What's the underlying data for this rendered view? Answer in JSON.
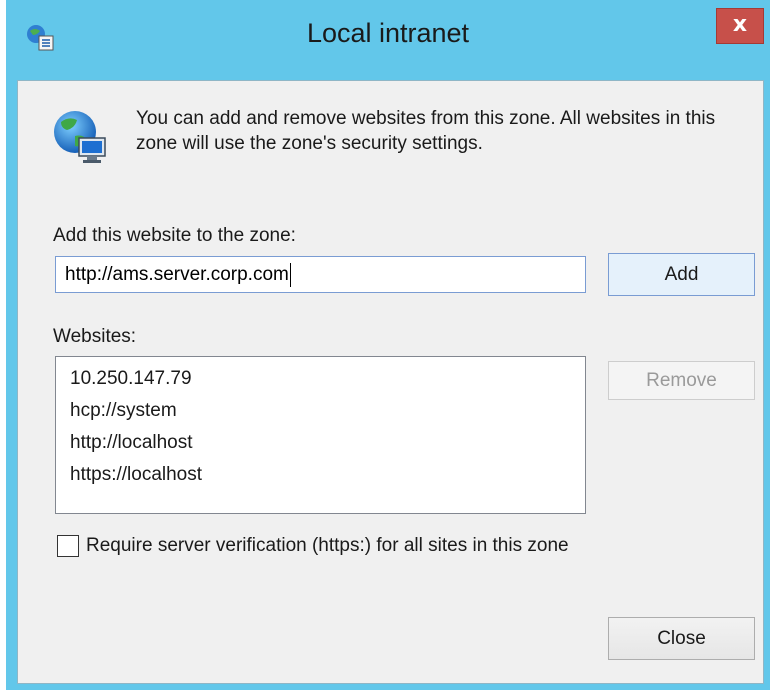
{
  "window": {
    "title": "Local intranet",
    "close_glyph": "x",
    "title_icon": "zone-settings-icon",
    "info_icon": "globe-computer-icon"
  },
  "info": {
    "text": "You can add and remove websites from this zone. All websites in this zone will use the zone's security settings."
  },
  "add_section": {
    "label": "Add this website to the zone:",
    "url_value": "http://ams.server.corp.com",
    "add_button": "Add"
  },
  "websites": {
    "label": "Websites:",
    "items": [
      "10.250.147.79",
      "hcp://system",
      "http://localhost",
      "https://localhost"
    ],
    "remove_button": "Remove"
  },
  "verification": {
    "label": "Require server verification (https:) for all sites in this zone",
    "checked": false
  },
  "footer": {
    "close_button": "Close"
  },
  "colors": {
    "titlebar": "#62c7ea",
    "close_button": "#c7504a",
    "client_bg": "#f0f0f0"
  }
}
